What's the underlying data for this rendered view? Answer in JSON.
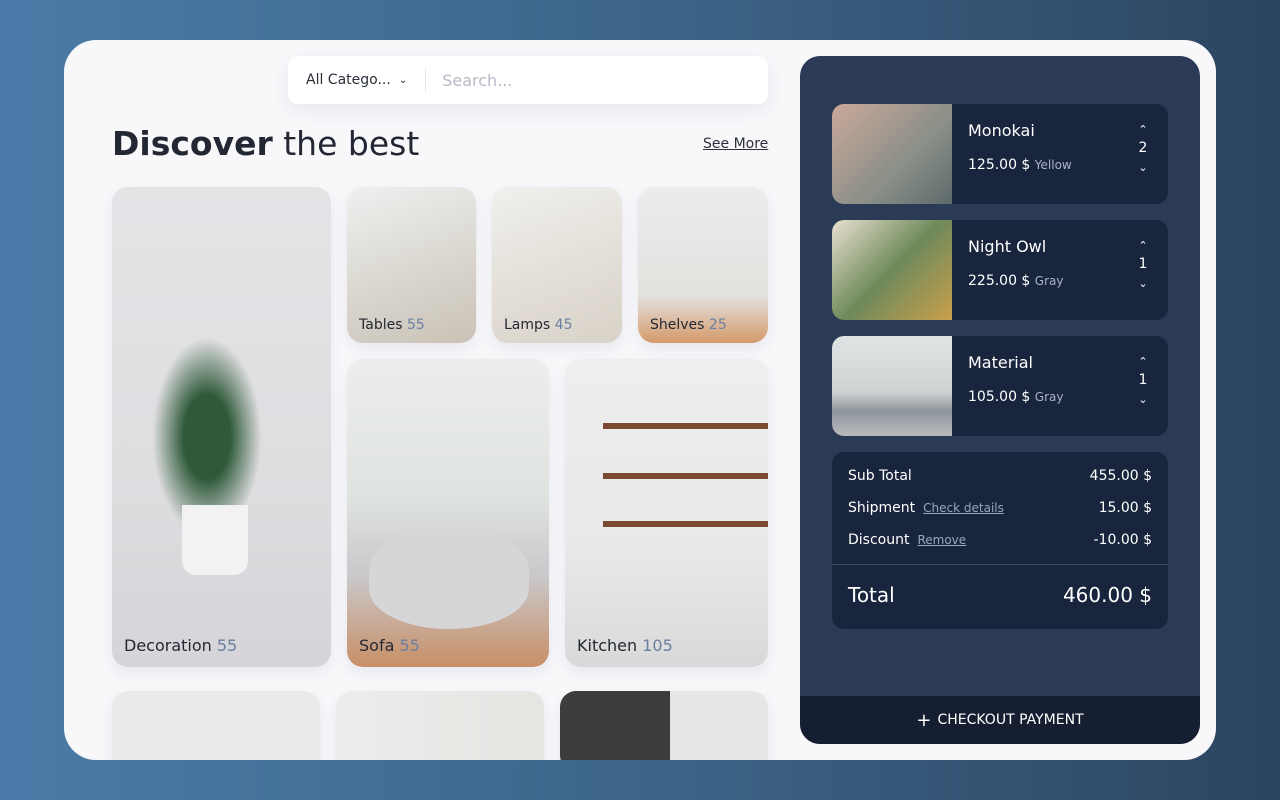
{
  "search": {
    "category": "All Catego...",
    "placeholder": "Search..."
  },
  "heading": {
    "bold": "Discover",
    "rest": " the best",
    "see_more": "See More"
  },
  "categories": [
    {
      "name": "Decoration",
      "count": "55"
    },
    {
      "name": "Tables",
      "count": "55"
    },
    {
      "name": "Lamps",
      "count": "45"
    },
    {
      "name": "Shelves",
      "count": "25"
    },
    {
      "name": "Sofa",
      "count": "55"
    },
    {
      "name": "Kitchen",
      "count": "105"
    }
  ],
  "cart": [
    {
      "name": "Monokai",
      "price": "125.00 $",
      "color": "Yellow",
      "qty": "2"
    },
    {
      "name": "Night Owl",
      "price": "225.00 $",
      "color": "Gray",
      "qty": "1"
    },
    {
      "name": "Material",
      "price": "105.00 $",
      "color": "Gray",
      "qty": "1"
    }
  ],
  "summary": {
    "subtotal_label": "Sub Total",
    "subtotal": "455.00 $",
    "shipment_label": "Shipment",
    "shipment_link": "Check details",
    "shipment": "15.00 $",
    "discount_label": "Discount",
    "discount_link": "Remove",
    "discount": "-10.00 $",
    "total_label": "Total",
    "total": "460.00 $"
  },
  "checkout_label": "CHECKOUT PAYMENT"
}
